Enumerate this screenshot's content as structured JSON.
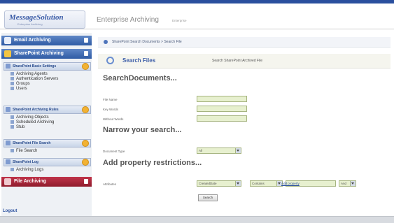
{
  "header": {
    "logo_text": "MessageSolution",
    "logo_tagline": "Enterprise Archiving",
    "app_title": "Enterprise Archiving",
    "app_subtitle": "Enterprise"
  },
  "sidebar": {
    "bars": [
      {
        "label": "Email Archiving",
        "color": "#3d6bb5"
      },
      {
        "label": "SharePoint Archiving",
        "color": "#3d6bb5"
      },
      {
        "label": "File Archiving",
        "color": "#a82438"
      }
    ],
    "sections": [
      {
        "label": "SharePoint Basic Settings",
        "items": [
          "Archiving Agents",
          "Authentication Servers",
          "Groups",
          "Users"
        ]
      },
      {
        "label": "SharePoint Archiving Rules",
        "items": [
          "Archiving Objects",
          "Scheduled Archiving",
          "Stub"
        ]
      },
      {
        "label": "SharePoint File Search",
        "items": [
          "File Search"
        ]
      },
      {
        "label": "SharePoint Log",
        "items": [
          "Archiving Logs"
        ]
      }
    ],
    "logout": "Logout"
  },
  "main": {
    "breadcrumb": "SharePoint Search Documents > Search File",
    "search_files_title": "Search Files",
    "search_files_desc": "Search SharePoint Archived File",
    "search_documents_title": "SearchDocuments...",
    "fields": [
      {
        "label": "File Name",
        "value": ""
      },
      {
        "label": "Key Words",
        "value": ""
      },
      {
        "label": "Without Words",
        "value": ""
      }
    ],
    "narrow_title": "Narrow your search...",
    "document_type_label": "Document Type",
    "document_type_value": "All",
    "property_title": "Add property restrictions...",
    "attributes_label": "Attributes",
    "attr_property": "CreatedDate",
    "attr_operator": "Contains",
    "attr_value": "",
    "attr_logic": "And",
    "add_property_link": "Add property",
    "search_button": "Search"
  },
  "colors": {
    "accent": "#2a4f9e",
    "input_bg": "#e7f0cf"
  }
}
